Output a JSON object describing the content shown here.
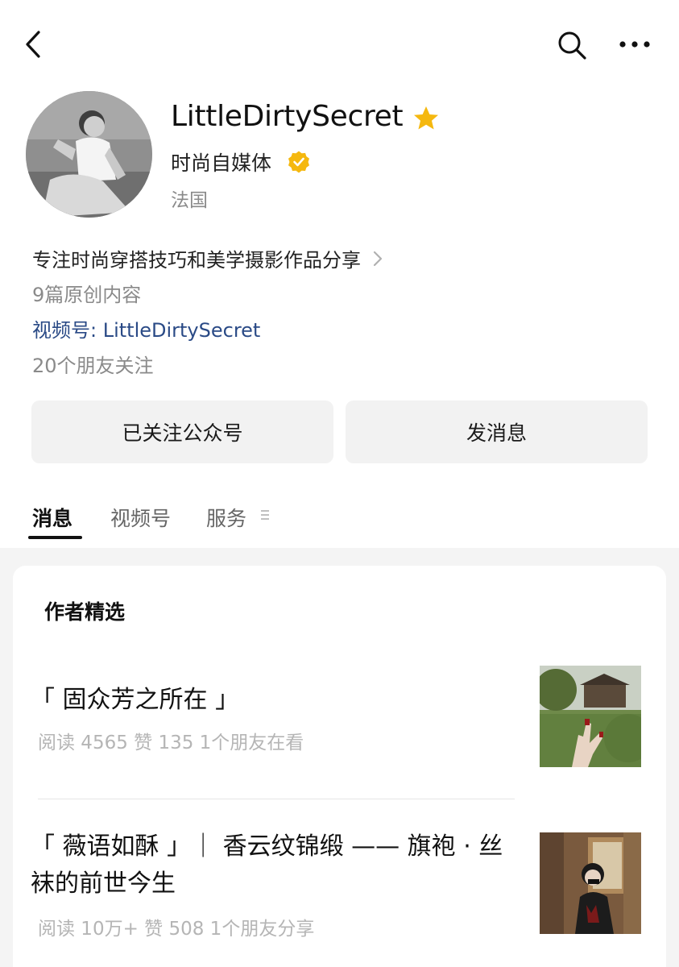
{
  "nav": {
    "back_icon": "back-chevron-icon",
    "search_icon": "search-icon",
    "more_icon": "more-dots-icon"
  },
  "profile": {
    "name": "LittleDirtySecret",
    "star_icon": "star-icon",
    "category": "时尚自媒体",
    "verified_icon": "verified-badge-icon",
    "region": "法国",
    "description": "专注时尚穿搭技巧和美学摄影作品分享",
    "original_count": "9篇原创内容",
    "channel": "视频号: LittleDirtySecret",
    "friends_following": "20个朋友关注"
  },
  "buttons": {
    "followed": "已关注公众号",
    "message": "发消息"
  },
  "tabs": [
    {
      "label": "消息",
      "active": true
    },
    {
      "label": "视频号",
      "active": false
    },
    {
      "label": "服务",
      "active": false
    }
  ],
  "section": {
    "title": "作者精选"
  },
  "articles": [
    {
      "title": "「 固众芳之所在 」",
      "meta": "阅读 4565  赞 135  1个朋友在看"
    },
    {
      "title": "「 薇语如酥 」｜ 香云纹锦缎 —— 旗袍 · 丝袜的前世今生",
      "meta": "阅读 10万+  赞 508  1个朋友分享"
    }
  ],
  "colors": {
    "accent_gold": "#f5b80f",
    "link_blue": "#2a4a86",
    "muted_gray": "#8a8a8a"
  }
}
